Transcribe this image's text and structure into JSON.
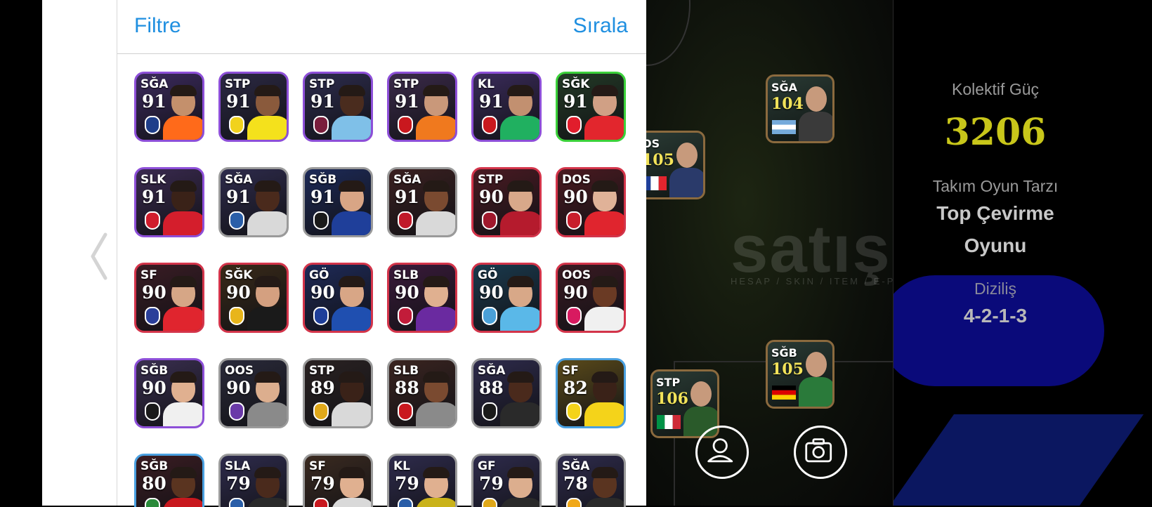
{
  "panel": {
    "filter_label": "Filtre",
    "sort_label": "Sırala",
    "cards": [
      {
        "pos": "SĞA",
        "ovr": "91",
        "border": "#8d4fd8",
        "bg": "#3c2a5e",
        "badge": "#1f3e8a",
        "shirt": "#ff6a1a",
        "skin": "#c4906c"
      },
      {
        "pos": "STP",
        "ovr": "91",
        "border": "#8d4fd8",
        "bg": "#2c2944",
        "badge": "#f1d21d",
        "shirt": "#f4e11c",
        "skin": "#8a5a3c"
      },
      {
        "pos": "STP",
        "ovr": "91",
        "border": "#8d4fd8",
        "bg": "#2d2c4e",
        "badge": "#7a1e3c",
        "shirt": "#7fc0e8",
        "skin": "#4a2c1e"
      },
      {
        "pos": "STP",
        "ovr": "91",
        "border": "#8d4fd8",
        "bg": "#3b2a4a",
        "badge": "#c9181e",
        "shirt": "#f0791e",
        "skin": "#c9987a"
      },
      {
        "pos": "KL",
        "ovr": "91",
        "border": "#8d4fd8",
        "bg": "#3a2b5a",
        "badge": "#c9181e",
        "shirt": "#20b060",
        "skin": "#c29070"
      },
      {
        "pos": "SĞK",
        "ovr": "91",
        "border": "#3bd13a",
        "bg": "#233a26",
        "badge": "#e11d2c",
        "shirt": "#e2262d",
        "skin": "#d0a085"
      },
      {
        "pos": "SLK",
        "ovr": "91",
        "border": "#8d4fd8",
        "bg": "#3a2a50",
        "badge": "#d01c2c",
        "shirt": "#d41e2c",
        "skin": "#3a2218"
      },
      {
        "pos": "SĞA",
        "ovr": "91",
        "border": "#9a9a9a",
        "bg": "#2e2b4c",
        "badge": "#2a5ea8",
        "shirt": "#d9d9d9",
        "skin": "#4a2a1c"
      },
      {
        "pos": "SĞB",
        "ovr": "91",
        "border": "#9a9a9a",
        "bg": "#1d2a58",
        "badge": "#1a1a1a",
        "shirt": "#1f3f9a",
        "skin": "#d8a585"
      },
      {
        "pos": "SĞA",
        "ovr": "91",
        "border": "#9a9a9a",
        "bg": "#3a2020",
        "badge": "#c01a2a",
        "shirt": "#d9d9d9",
        "skin": "#7a4a30"
      },
      {
        "pos": "STP",
        "ovr": "90",
        "border": "#d3344a",
        "bg": "#4a1a22",
        "badge": "#a0182c",
        "shirt": "#b51b2d",
        "skin": "#d8a88a"
      },
      {
        "pos": "DOS",
        "ovr": "90",
        "border": "#d3344a",
        "bg": "#4a1a20",
        "badge": "#c81e2c",
        "shirt": "#e0252e",
        "skin": "#e0b298"
      },
      {
        "pos": "SF",
        "ovr": "90",
        "border": "#d3344a",
        "bg": "#3a1c24",
        "badge": "#2a3f9a",
        "shirt": "#e0252e",
        "skin": "#d6a686"
      },
      {
        "pos": "SĞK",
        "ovr": "90",
        "border": "#d3344a",
        "bg": "#3a2a18",
        "badge": "#e8b51a",
        "shirt": "#1a1a1a",
        "skin": "#d4a080"
      },
      {
        "pos": "GÖ",
        "ovr": "90",
        "border": "#d3344a",
        "bg": "#1e2a58",
        "badge": "#1f3f9a",
        "shirt": "#1f4fb0",
        "skin": "#d8a686"
      },
      {
        "pos": "SLB",
        "ovr": "90",
        "border": "#d3344a",
        "bg": "#3a1a3a",
        "badge": "#c21c3a",
        "shirt": "#6a2aa0",
        "skin": "#e0b090"
      },
      {
        "pos": "GÖ",
        "ovr": "90",
        "border": "#d3344a",
        "bg": "#1a3a4e",
        "badge": "#4aa0d8",
        "shirt": "#5ab8e8",
        "skin": "#d8a888"
      },
      {
        "pos": "OOS",
        "ovr": "90",
        "border": "#d3344a",
        "bg": "#3a1a22",
        "badge": "#d81a60",
        "shirt": "#f0f0f0",
        "skin": "#6a3a24"
      },
      {
        "pos": "SĞB",
        "ovr": "90",
        "border": "#8d4fd8",
        "bg": "#3a2f50",
        "badge": "#1a1a1a",
        "shirt": "#f0f0f0",
        "skin": "#e0b090"
      },
      {
        "pos": "OOS",
        "ovr": "90",
        "border": "#9a9a9a",
        "bg": "#2a2a3a",
        "badge": "#6a3aa8",
        "shirt": "#8a8a8a",
        "skin": "#dcae8e"
      },
      {
        "pos": "STP",
        "ovr": "89",
        "border": "#9a9a9a",
        "bg": "#2a2222",
        "badge": "#e0a81a",
        "shirt": "#d9d9d9",
        "skin": "#3a2218"
      },
      {
        "pos": "SLB",
        "ovr": "88",
        "border": "#9a9a9a",
        "bg": "#3a2420",
        "badge": "#c9181e",
        "shirt": "#8a8a8a",
        "skin": "#7a4a30"
      },
      {
        "pos": "SĞA",
        "ovr": "88",
        "border": "#9a9a9a",
        "bg": "#2e2b4c",
        "badge": "#1a1a1a",
        "shirt": "#2a2a2a",
        "skin": "#4a2a1c"
      },
      {
        "pos": "SF",
        "ovr": "82",
        "border": "#4aa0e0",
        "bg": "#5a4a1a",
        "badge": "#f4d31a",
        "shirt": "#f4d31a",
        "skin": "#3a2218"
      },
      {
        "pos": "SĞB",
        "ovr": "80",
        "border": "#4aa0e0",
        "bg": "#3a1c22",
        "badge": "#2a8a3a",
        "shirt": "#c8181e",
        "skin": "#5a3420"
      },
      {
        "pos": "SLA",
        "ovr": "79",
        "border": "#9a9a9a",
        "bg": "#2e2b4c",
        "badge": "#2a5ea8",
        "shirt": "#2a2a2a",
        "skin": "#4a2a1c"
      },
      {
        "pos": "SF",
        "ovr": "79",
        "border": "#9a9a9a",
        "bg": "#3a2a20",
        "badge": "#c8181e",
        "shirt": "#d9d9d9",
        "skin": "#e0b090"
      },
      {
        "pos": "KL",
        "ovr": "79",
        "border": "#9a9a9a",
        "bg": "#2e2b4c",
        "badge": "#2a5ea8",
        "shirt": "#c9b21a",
        "skin": "#e0b090"
      },
      {
        "pos": "GF",
        "ovr": "79",
        "border": "#9a9a9a",
        "bg": "#2e2b4c",
        "badge": "#e0a81a",
        "shirt": "#2a2a2a",
        "skin": "#dcae8e"
      },
      {
        "pos": "SĞA",
        "ovr": "78",
        "border": "#9a9a9a",
        "bg": "#2e2b4c",
        "badge": "#f0a81a",
        "shirt": "#2a2a2a",
        "skin": "#5a3420"
      }
    ]
  },
  "pitch": {
    "watermark": "satış",
    "watermark_sub": "HESAP / SKIN / ITEM / E-PIN .com",
    "players": [
      {
        "pos": "SĞA",
        "ovr": "104",
        "flag": "argentina"
      },
      {
        "pos": "OS",
        "ovr": "105",
        "flag": "france"
      },
      {
        "pos": "SĞB",
        "ovr": "105",
        "flag": "germany"
      },
      {
        "pos": "STP",
        "ovr": "106",
        "flag": "italy"
      }
    ]
  },
  "team": {
    "power_label": "Kolektif Güç",
    "power_value": "3206",
    "style_label": "Takım Oyun Tarzı",
    "style_line1": "Top Çevirme",
    "style_line2": "Oyunu",
    "formation_label": "Diziliş",
    "formation_value": "4-2-1-3"
  },
  "icons": {
    "prev": "chevron-left-icon",
    "profile": "person-icon",
    "camera": "camera-icon"
  }
}
